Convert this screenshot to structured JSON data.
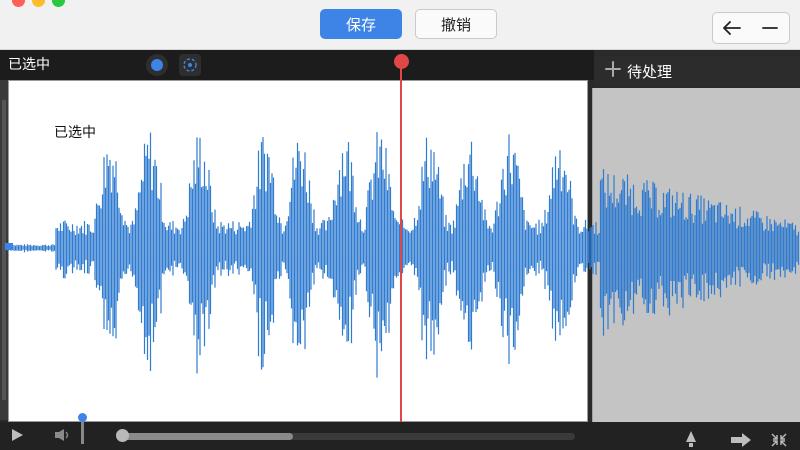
{
  "toolbar": {
    "save_label": "保存",
    "undo_label": "撤销"
  },
  "nav": {
    "back_icon": "arrow-left-icon",
    "minimize_icon": "minus-icon"
  },
  "track": {
    "selected_label": "已选中",
    "waveform_label": "已选中",
    "pending_label": "待处理"
  },
  "transport": {
    "seek_progress": 0.38
  },
  "colors": {
    "accent": "#3d84e6",
    "playhead": "#e04848",
    "waveform": "#2f7bd0"
  }
}
